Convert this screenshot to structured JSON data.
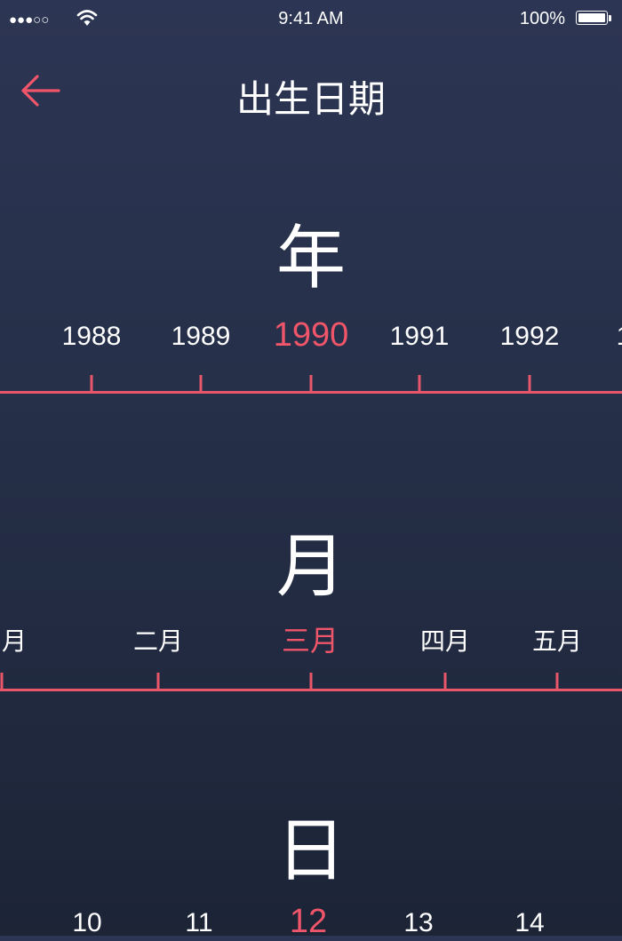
{
  "status_bar": {
    "signal": "●●●○○",
    "time": "9:41 AM",
    "battery": "100%"
  },
  "header": {
    "back_icon": "arrow-left-icon",
    "title": "出生日期"
  },
  "colors": {
    "accent": "#f0556a",
    "background_top": "#2c3553",
    "background_bottom": "#1c2436",
    "text": "#ffffff"
  },
  "year_picker": {
    "label": "年",
    "items": [
      "1988",
      "1989",
      "1990",
      "1991",
      "1992",
      "1"
    ],
    "selected": "1990"
  },
  "month_picker": {
    "label": "月",
    "items": [
      "月",
      "二月",
      "三月",
      "四月",
      "五月"
    ],
    "selected": "三月"
  },
  "day_picker": {
    "label": "日",
    "items": [
      "10",
      "11",
      "12",
      "13",
      "14"
    ],
    "selected": "12"
  }
}
